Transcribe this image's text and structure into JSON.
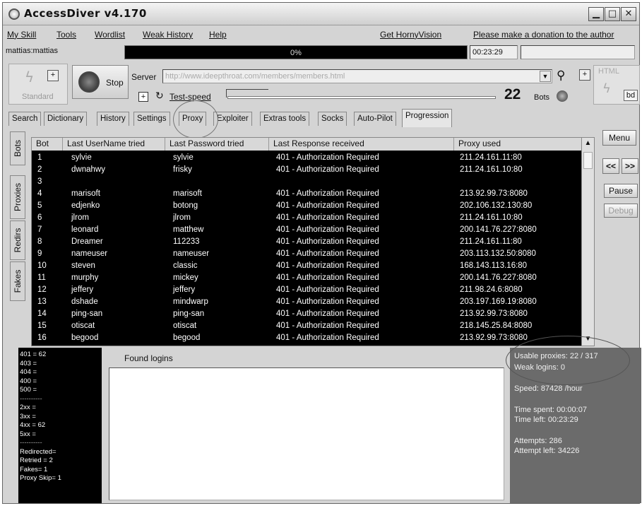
{
  "window": {
    "title": "AccessDiver v4.170"
  },
  "menu": {
    "items": [
      "My Skill",
      "Tools",
      "Wordlist",
      "Weak History",
      "Help",
      "Get HornyVision",
      "Please make a donation to the author"
    ]
  },
  "status": {
    "user": "mattias:mattias",
    "progress_text": "0%",
    "progress": 0,
    "timer": "00:23:29"
  },
  "toolbar": {
    "standard_label": "Standard",
    "stop_label": "Stop",
    "server_label": "Server",
    "server_url": "http://www.ideepthroat.com/members/members.html",
    "testspeed_label": "Test-speed",
    "bots_count": "22",
    "bots_label": "Bots",
    "html_label": "HTML",
    "bd_label": "bd"
  },
  "tabs": [
    "Search",
    "Dictionary",
    "History",
    "Settings",
    "Proxy",
    "Exploiter",
    "Extras tools",
    "Socks",
    "Auto-Pilot",
    "Progression"
  ],
  "active_tab": "Progression",
  "side_tabs": [
    "Bots",
    "Proxies",
    "Redirs",
    "Fakes"
  ],
  "table": {
    "columns": [
      "Bot",
      "Last UserName tried",
      "Last Password tried",
      "Last Response received",
      "Proxy used"
    ],
    "rows": [
      [
        "1",
        "sylvie",
        "sylvie",
        "401 - Authorization Required",
        "211.24.161.11:80"
      ],
      [
        "2",
        "dwnahwy",
        "frisky",
        "401 - Authorization Required",
        "211.24.161.10:80"
      ],
      [
        "3",
        "",
        "",
        "",
        ""
      ],
      [
        "4",
        "marisoft",
        "marisoft",
        "401 - Authorization Required",
        "213.92.99.73:8080"
      ],
      [
        "5",
        "edjenko",
        "botong",
        "401 - Authorization Required",
        "202.106.132.130:80"
      ],
      [
        "6",
        "jlrom",
        "jlrom",
        "401 - Authorization Required",
        "211.24.161.10:80"
      ],
      [
        "7",
        "leonard",
        "matthew",
        "401 - Authorization Required",
        "200.141.76.227:8080"
      ],
      [
        "8",
        "Dreamer",
        "112233",
        "401 - Authorization Required",
        "211.24.161.11:80"
      ],
      [
        "9",
        "nameuser",
        "nameuser",
        "401 - Authorization Required",
        "203.113.132.50:8080"
      ],
      [
        "10",
        "steven",
        "classic",
        "401 - Authorization Required",
        "168.143.113.16:80"
      ],
      [
        "11",
        "murphy",
        "mickey",
        "401 - Authorization Required",
        "200.141.76.227:8080"
      ],
      [
        "12",
        "jeffery",
        "jeffery",
        "401 - Authorization Required",
        "211.98.24.6:8080"
      ],
      [
        "13",
        "dshade",
        "mindwarp",
        "401 - Authorization Required",
        "203.197.169.19:8080"
      ],
      [
        "14",
        "ping-san",
        "ping-san",
        "401 - Authorization Required",
        "213.92.99.73:8080"
      ],
      [
        "15",
        "otiscat",
        "otiscat",
        "401 - Authorization Required",
        "218.145.25.84:8080"
      ],
      [
        "16",
        "begood",
        "begood",
        "401 - Authorization Required",
        "213.92.99.73:8080"
      ]
    ]
  },
  "right_buttons": {
    "menu": "Menu",
    "prev": "<<",
    "next": ">>",
    "pause": "Pause",
    "debug": "Debug"
  },
  "stats": {
    "lines_a": [
      "401 = 62",
      "403 =",
      "404 =",
      "400 =",
      "500 ="
    ],
    "sep": "----------",
    "lines_b": [
      "2xx =",
      "3xx =",
      "4xx = 62",
      "5xx ="
    ],
    "lines_c": [
      "Redirected=",
      "Retried = 2",
      "Fakes= 1",
      "Proxy Skip= 1"
    ]
  },
  "found": {
    "title": "Found logins"
  },
  "info": {
    "usable_proxies": "Usable proxies: 22 / 317",
    "weak_logins": "Weak logins: 0",
    "speed": "Speed: 87428 /hour",
    "time_spent": "Time spent: 00:00:07",
    "time_left": "Time left:  00:23:29",
    "attempts": "Attempts: 286",
    "attempt_left": "Attempt left: 34226"
  }
}
